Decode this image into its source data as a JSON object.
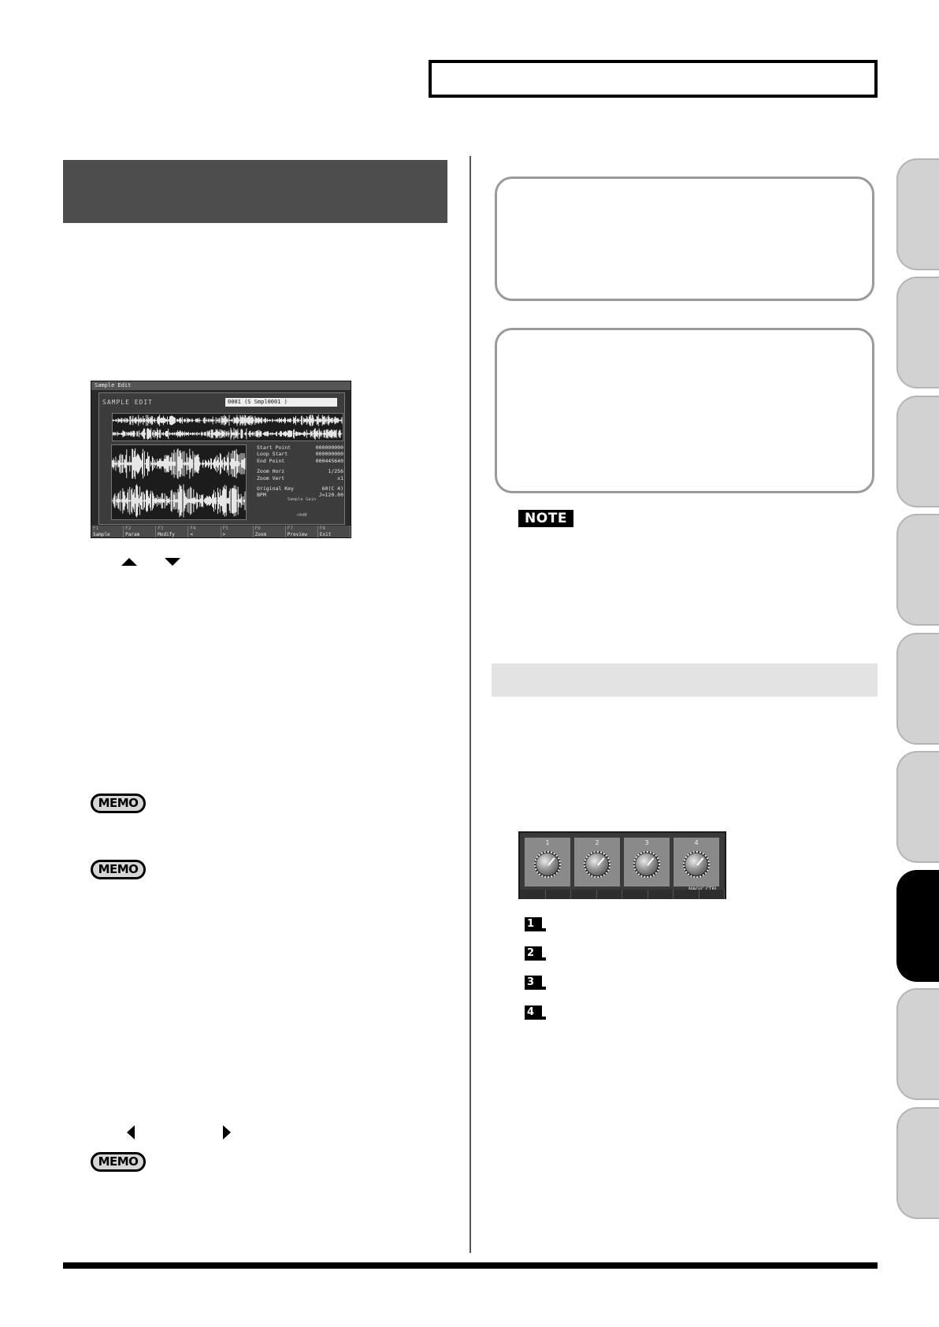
{
  "screen": {
    "window_title": "Sample Edit",
    "app_title": "SAMPLE EDIT",
    "sample_name": "0001 (S Smpl0001 )",
    "params": [
      {
        "label": "Start Point",
        "value": "000000000"
      },
      {
        "label": "Loop Start",
        "value": "000000000"
      },
      {
        "label": "End Point",
        "value": "000445640"
      },
      {
        "label": "Zoom Horz",
        "value": "1/256"
      },
      {
        "label": "Zoom Vert",
        "value": "x1"
      },
      {
        "label": "Original Key",
        "value": "60(C 4)"
      },
      {
        "label": "BPM",
        "value": "J=120.00"
      }
    ],
    "gain_label": "Sample Gain",
    "gain_value": "+0dB",
    "fkeys": [
      {
        "num": "F1",
        "label": "Sample List"
      },
      {
        "num": "F2",
        "label": "Param"
      },
      {
        "num": "F3",
        "label": "Modify"
      },
      {
        "num": "F4",
        "label": "<"
      },
      {
        "num": "F5",
        "label": ">"
      },
      {
        "num": "F6",
        "label": "Zoom"
      },
      {
        "num": "F7",
        "label": "Preview"
      },
      {
        "num": "F8",
        "label": "Exit"
      }
    ]
  },
  "memo_label": "MEMO",
  "note_label": "NOTE",
  "knobs": {
    "numbers": [
      "1",
      "2",
      "3",
      "4"
    ],
    "magic_label": "MAGIC CTRL"
  },
  "num_icons": [
    "1",
    "2",
    "3",
    "4"
  ]
}
